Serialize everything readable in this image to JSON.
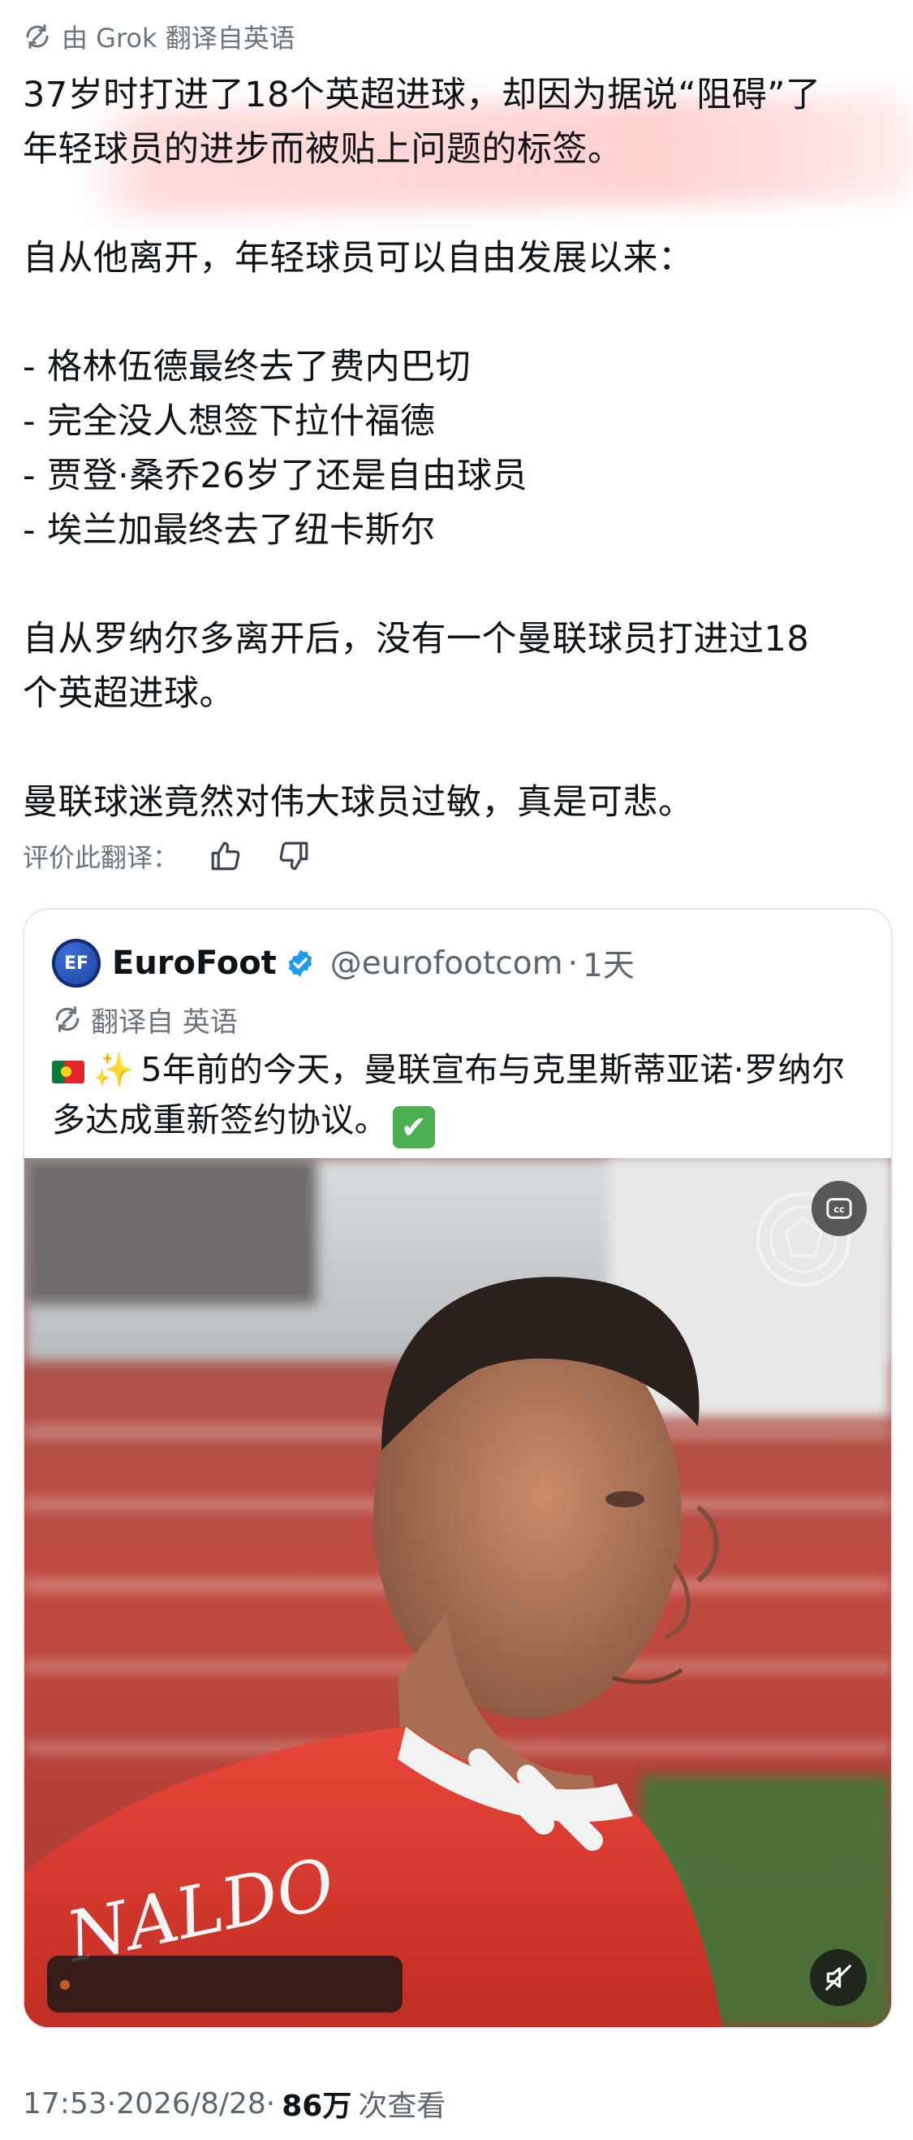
{
  "translation_header": {
    "label": "由 Grok 翻译自英语",
    "icon": "translate-icon"
  },
  "tweet": {
    "paragraphs": [
      [
        "37岁时打进了18个英超进球，却因为据说“阻碍”了",
        "年轻球员的进步而被贴上问题的标签。"
      ],
      [
        "自从他离开，年轻球员可以自由发展以来："
      ],
      [
        "- 格林伍德最终去了费内巴切",
        "- 完全没人想签下拉什福德",
        "- 贾登·桑乔26岁了还是自由球员",
        "- 埃兰加最终去了纽卡斯尔"
      ],
      [
        "自从罗纳尔多离开后，没有一个曼联球员打进过18",
        "个英超进球。"
      ],
      [
        "曼联球迷竟然对伟大球员过敏，真是可悲。"
      ]
    ]
  },
  "rate_translation": {
    "label": "评价此翻译：",
    "thumbs_up_icon": "thumbs-up-icon",
    "thumbs_down_icon": "thumbs-down-icon"
  },
  "quoted_tweet": {
    "avatar_text": "EF",
    "name": "EuroFoot",
    "handle": "@eurofootcom",
    "separator": "·",
    "time": "1天",
    "translated_label": "翻译自 英语",
    "text_line1": "5年前的今天，曼联宣布与克里斯蒂亚诺·罗纳尔",
    "text_line2": "多达成重新签约协议。",
    "emoji_flag": "portugal-flag-icon",
    "emoji_sparkle": "✨",
    "emoji_check": "✔",
    "video": {
      "cc_icon": "cc",
      "mute_icon": "mute-icon",
      "jersey_text": "NALDO"
    }
  },
  "footer": {
    "time": "17:53",
    "separator1": " · ",
    "date": "2026/8/28",
    "separator2": " · ",
    "views": "86万",
    "views_label": "次查看"
  },
  "colors": {
    "text": "#0f1419",
    "secondary": "#6b7580",
    "verified": "#1d9bf0",
    "highlight": "#ffbebe"
  }
}
